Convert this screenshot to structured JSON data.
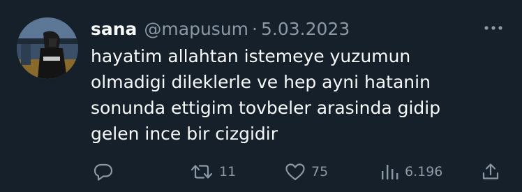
{
  "tweet": {
    "author": {
      "display_name": "sana",
      "handle": "@mapusum",
      "date": "5.03.2023"
    },
    "separator": "·",
    "body_lines": [
      "hayatim allahtan istemeye yuzumun",
      "olmadigi dileklerle ve hep ayni hatanin",
      "sonunda ettigim tovbeler arasinda gidip",
      "gelen ince bir cizgidir"
    ],
    "stats": {
      "replies": "",
      "retweets": "11",
      "likes": "75",
      "views": "6.196"
    }
  },
  "colors": {
    "background": "#15202b",
    "primary_text": "#f7f9f9",
    "secondary_text": "#8b98a5"
  },
  "icons": {
    "more": "more-dots-icon",
    "reply": "reply-icon",
    "retweet": "retweet-icon",
    "like": "heart-icon",
    "views": "views-bar-chart-icon",
    "share": "share-icon"
  }
}
